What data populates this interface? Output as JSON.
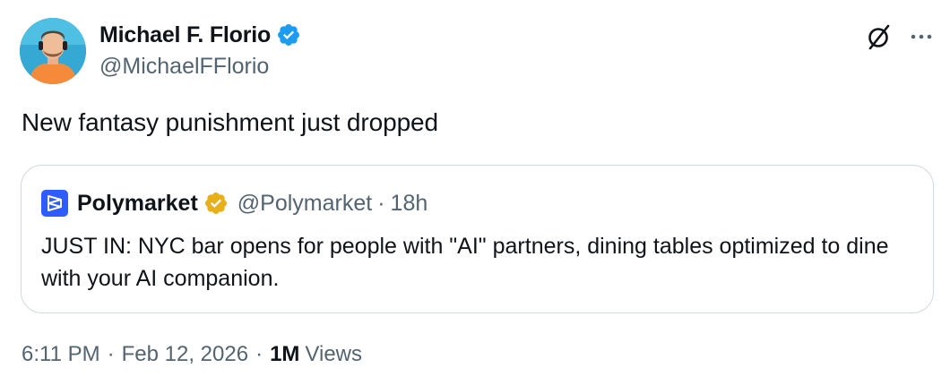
{
  "author": {
    "name": "Michael F. Florio",
    "handle": "@MichaelFFlorio",
    "verified_color": "#1d9bf0"
  },
  "tweet": {
    "text": "New fantasy punishment just dropped"
  },
  "quote": {
    "name": "Polymarket",
    "handle": "@Polymarket",
    "separator": "·",
    "time": "18h",
    "verified_color": "#e8b018",
    "logo_color": "#2e5cff",
    "text": "JUST IN: NYC bar opens for people with \"AI\" partners, dining tables optimized to dine with your AI companion."
  },
  "meta": {
    "time": "6:11 PM",
    "separator": "·",
    "date": "Feb 12, 2026",
    "views_count": "1M",
    "views_label": "Views"
  },
  "icons": {
    "avatar": "avatar",
    "verified": "verified-badge-icon",
    "grok": "grok-icon",
    "more": "more-icon",
    "quote_logo": "polymarket-logo-icon",
    "quote_verified": "gold-verified-badge-icon"
  }
}
